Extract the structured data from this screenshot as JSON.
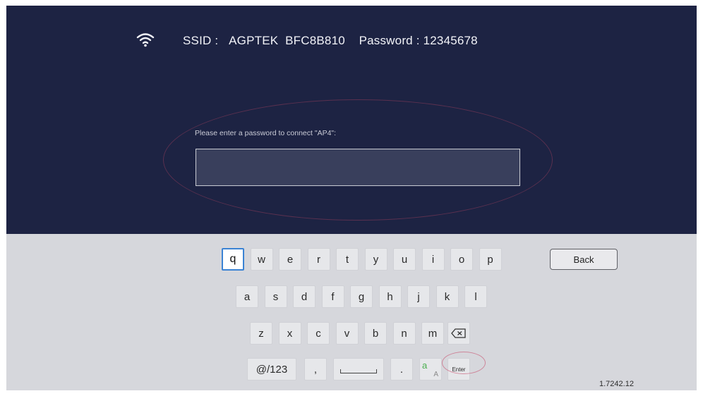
{
  "status": {
    "ssid_label": "SSID :",
    "ssid_value": "AGPTEK  BFC8B810",
    "password_label": "Password : 12345678"
  },
  "dialog": {
    "prompt": "Please enter a password to connect \"AP4\":",
    "input_value": "",
    "input_placeholder": ""
  },
  "keyboard": {
    "row1": [
      "q",
      "w",
      "e",
      "r",
      "t",
      "y",
      "u",
      "i",
      "o",
      "p"
    ],
    "row2": [
      "a",
      "s",
      "d",
      "f",
      "g",
      "h",
      "j",
      "k",
      "l"
    ],
    "row3": [
      "z",
      "x",
      "c",
      "v",
      "b",
      "n",
      "m"
    ],
    "symbols_key": "@/123",
    "comma_key": ",",
    "period_key": ".",
    "enter_key": "Enter",
    "lang_key_lower": "a",
    "lang_key_upper": "A",
    "back_label": "Back",
    "focused_key": "q"
  },
  "version": "1.7242.12",
  "colors": {
    "top_background": "#1d2343",
    "keyboard_background": "#d6d7dc",
    "focus_border": "#3b83d4"
  }
}
